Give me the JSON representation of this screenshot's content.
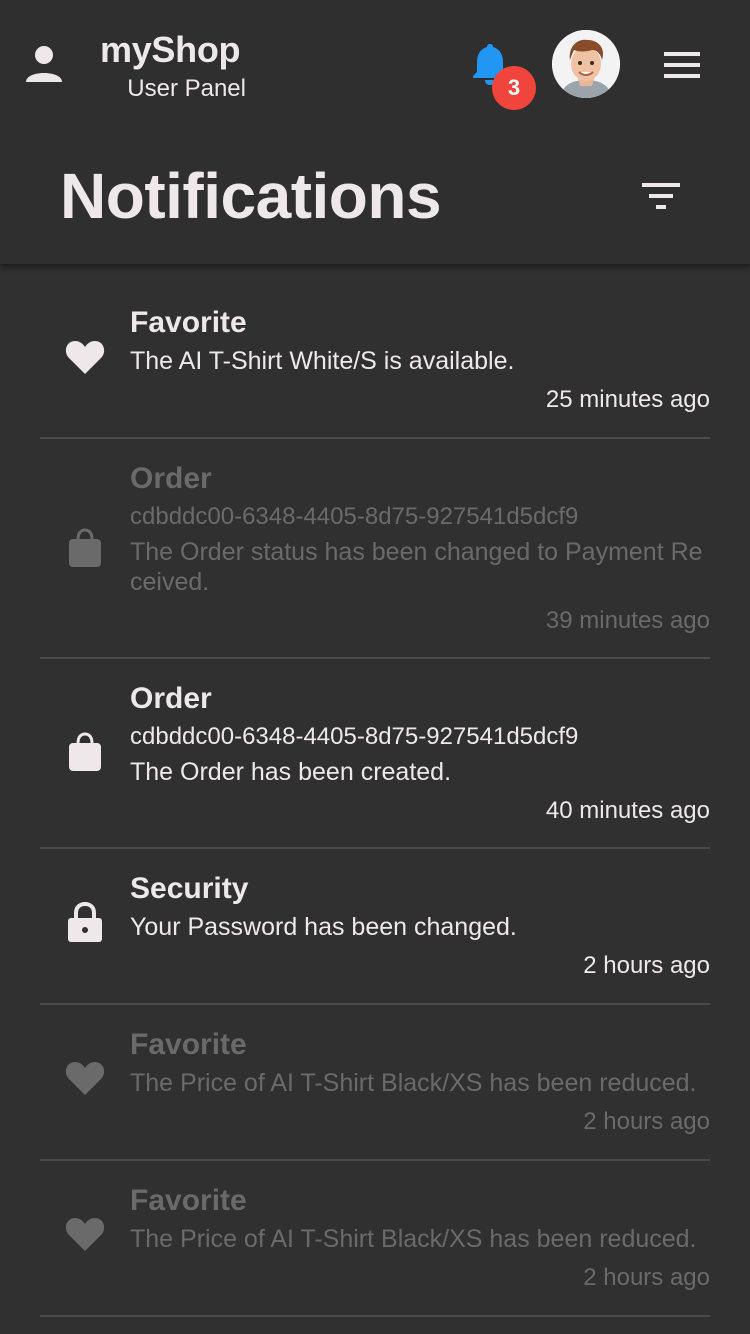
{
  "header": {
    "brand_title": "myShop",
    "brand_subtitle": "User Panel",
    "notification_count": "3",
    "page_title": "Notifications"
  },
  "colors": {
    "background": "#303030",
    "text": "#efe8ea",
    "muted": "#6a6a6a",
    "accent_bell": "#2196f3",
    "badge": "#f0443c"
  },
  "icons": {
    "user": "person-icon",
    "bell": "bell-icon",
    "menu": "hamburger-menu-icon",
    "filter": "filter-icon",
    "favorite": "heart-icon",
    "order": "shopping-bag-icon",
    "security": "lock-icon"
  },
  "notifications": [
    {
      "type": "favorite",
      "title": "Favorite",
      "ref": "",
      "message": "The AI T-Shirt White/S is available.",
      "time": "25 minutes ago",
      "read": false
    },
    {
      "type": "order",
      "title": "Order",
      "ref": "cdbddc00-6348-4405-8d75-927541d5dcf9",
      "message": "The Order status has been changed to Payment Received.",
      "time": "39 minutes ago",
      "read": true
    },
    {
      "type": "order",
      "title": "Order",
      "ref": "cdbddc00-6348-4405-8d75-927541d5dcf9",
      "message": "The Order has been created.",
      "time": "40 minutes ago",
      "read": false
    },
    {
      "type": "security",
      "title": "Security",
      "ref": "",
      "message": "Your Password has been changed.",
      "time": "2 hours ago",
      "read": false
    },
    {
      "type": "favorite",
      "title": "Favorite",
      "ref": "",
      "message": "The Price of AI T-Shirt Black/XS has been reduced.",
      "time": "2 hours ago",
      "read": true
    },
    {
      "type": "favorite",
      "title": "Favorite",
      "ref": "",
      "message": "The Price of AI T-Shirt Black/XS has been reduced.",
      "time": "2 hours ago",
      "read": true
    }
  ]
}
